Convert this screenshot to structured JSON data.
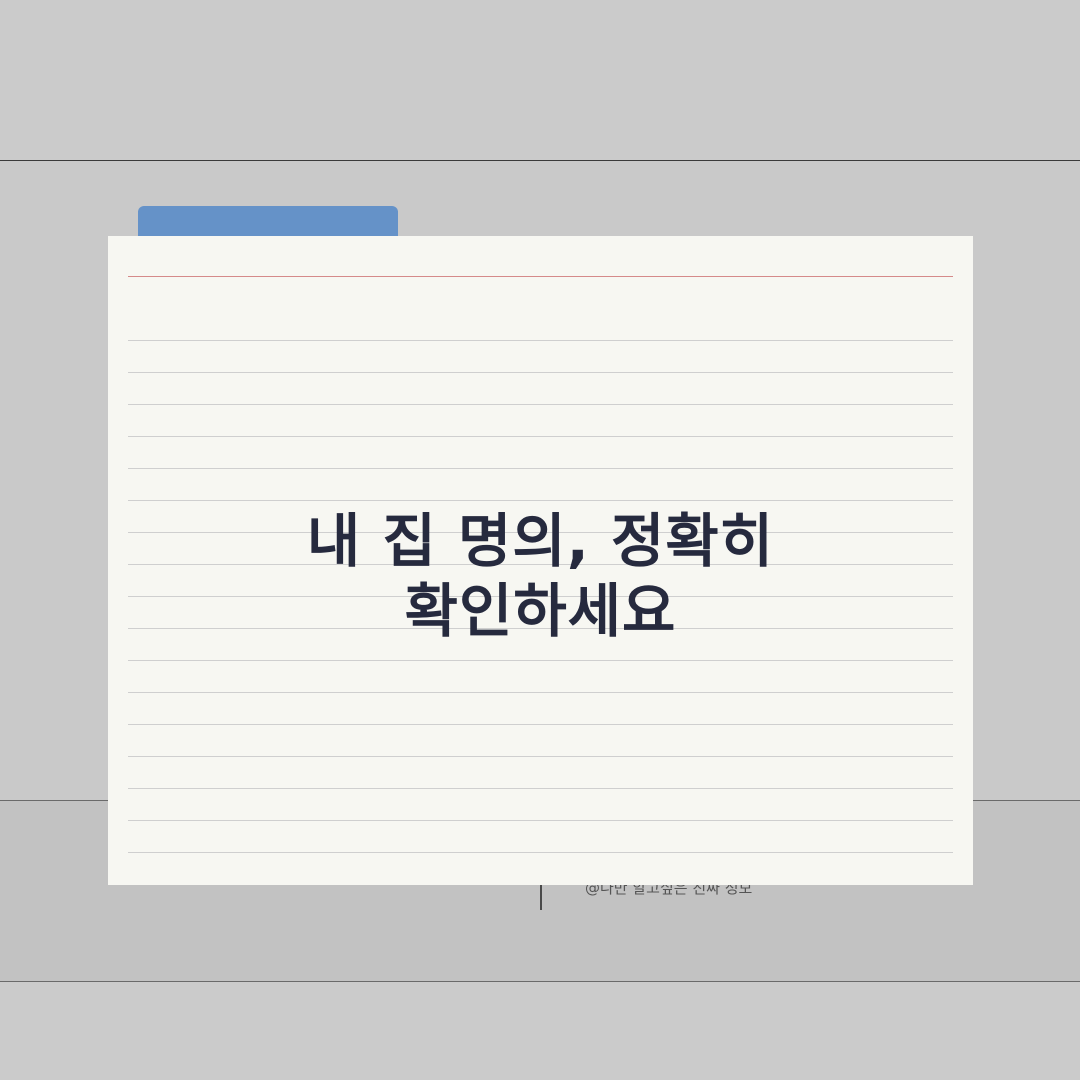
{
  "card": {
    "title_line1": "내 집 명의, 정확히",
    "title_line2": "확인하세요"
  },
  "footer": {
    "caption": "@나만 알고싶은 진짜 정보"
  },
  "colors": {
    "background": "#cbcbcb",
    "card": "#f7f7f2",
    "folder_tab": "#6592c8",
    "margin_line": "#d58a8a",
    "title": "#262a3e"
  }
}
